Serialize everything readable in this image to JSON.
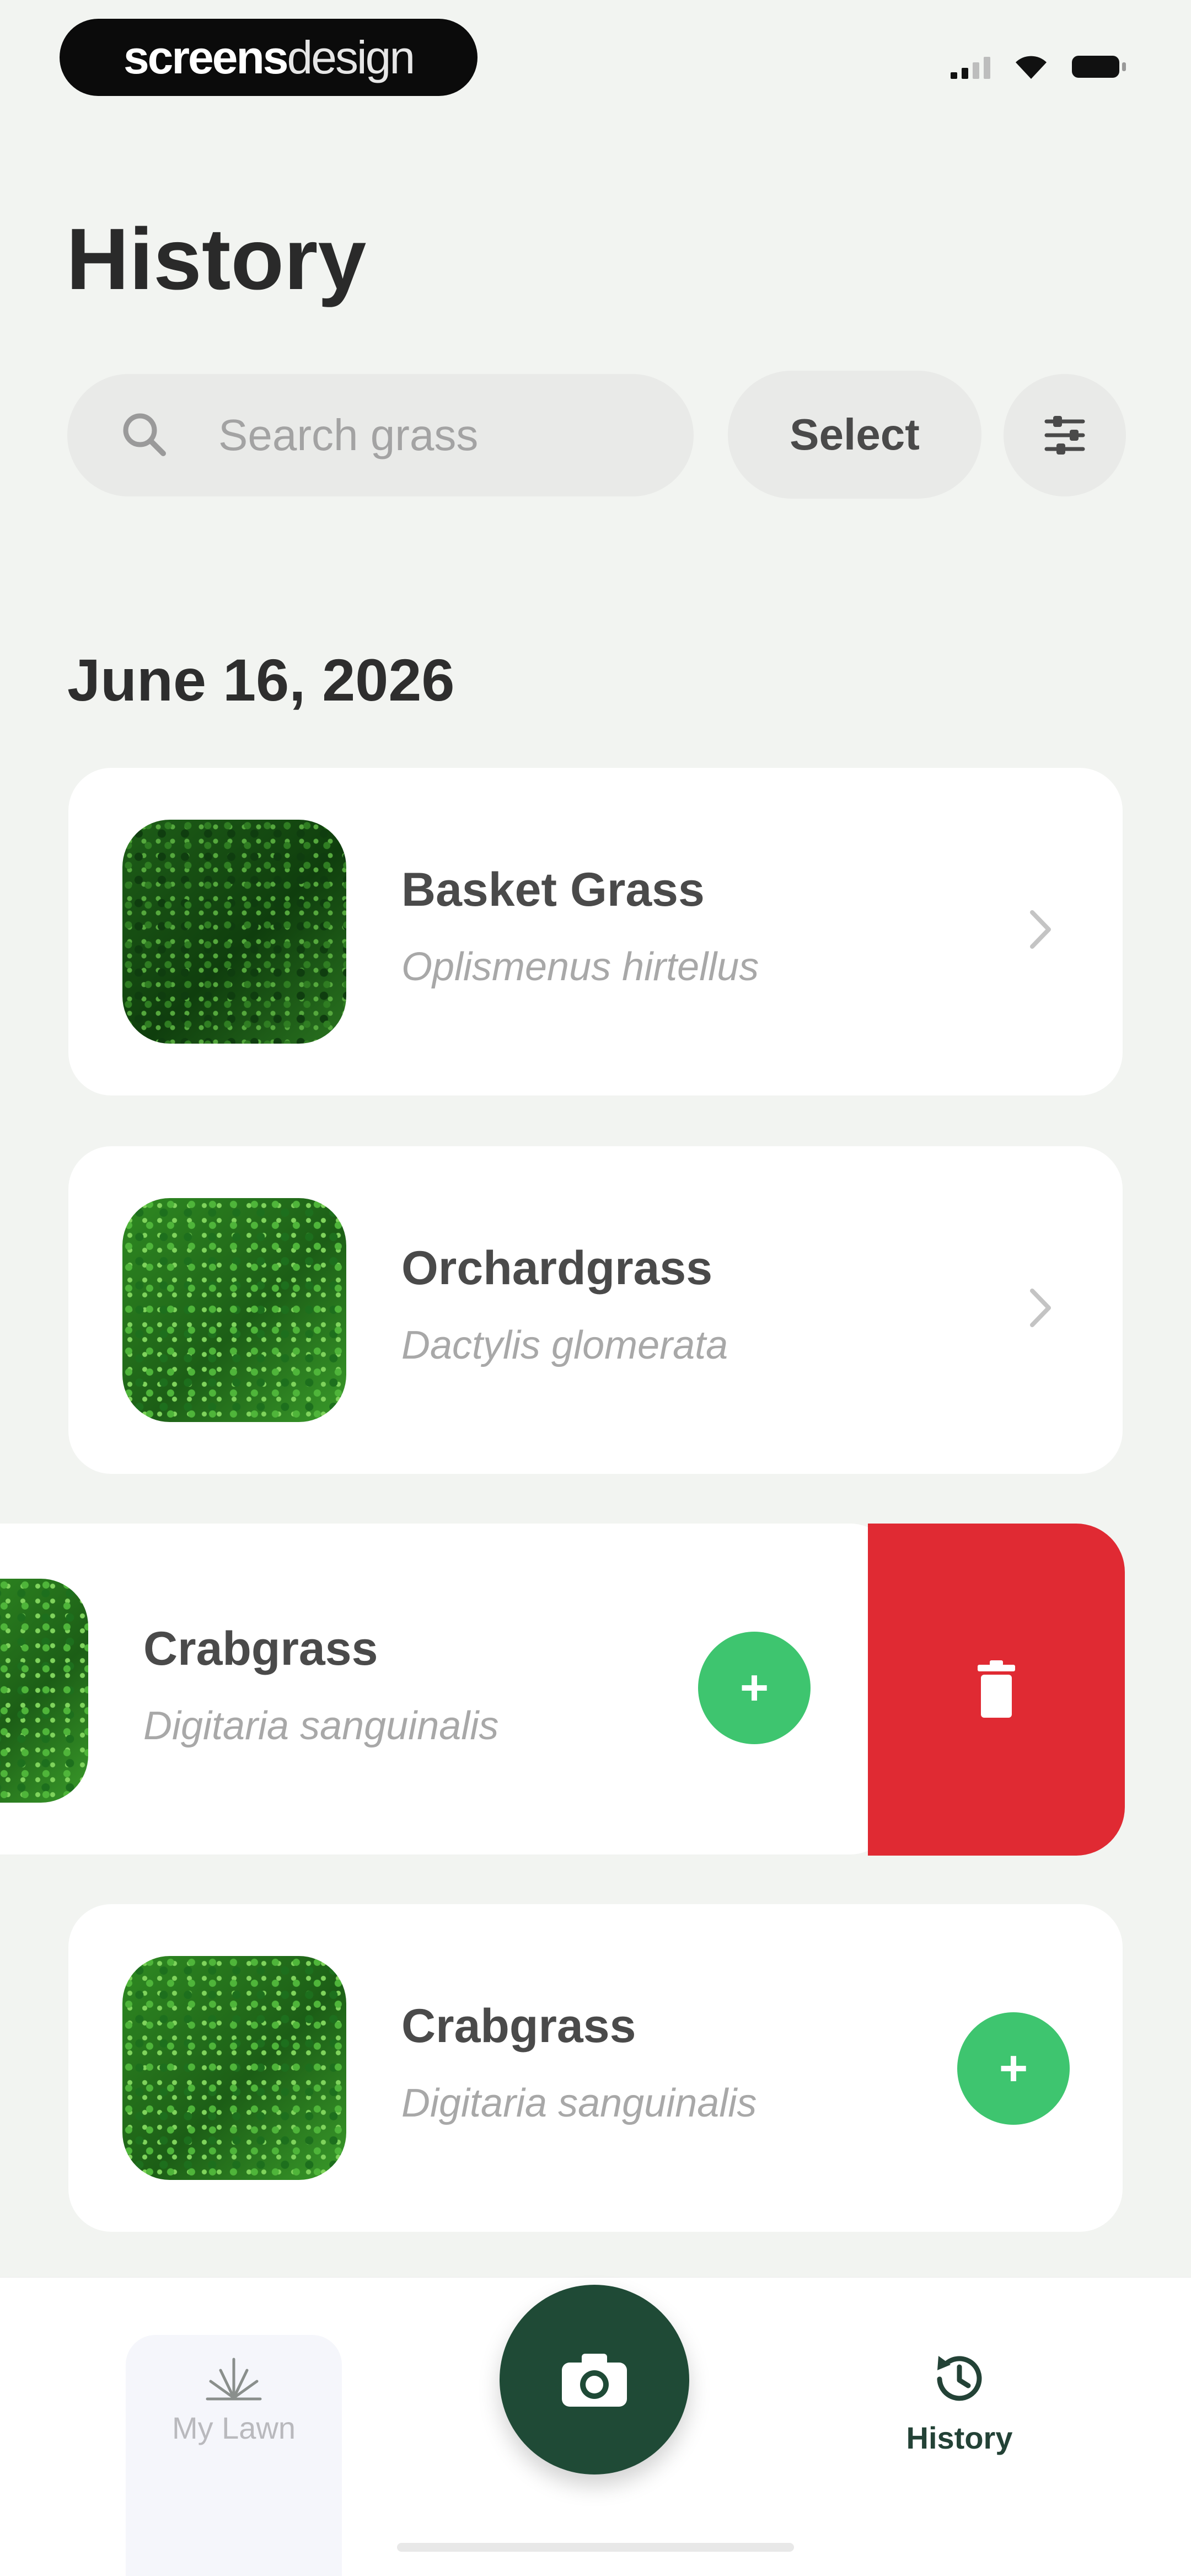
{
  "status_bar": {
    "brand_bold": "screens",
    "brand_light": "design"
  },
  "header": {
    "title": "History"
  },
  "search": {
    "placeholder": "Search grass",
    "select_label": "Select"
  },
  "sections": [
    {
      "date": "June 16, 2026",
      "items": [
        {
          "name": "Basket Grass",
          "scientific_name": "Oplismenus hirtellus",
          "action": "chevron"
        },
        {
          "name": "Orchardgrass",
          "scientific_name": "Dactylis glomerata",
          "action": "chevron"
        },
        {
          "name": "Crabgrass",
          "scientific_name": "Digitaria sanguinalis",
          "action": "add",
          "swiped": true
        },
        {
          "name": "Crabgrass",
          "scientific_name": "Digitaria sanguinalis",
          "action": "add"
        }
      ]
    }
  ],
  "tabbar": {
    "tabs": [
      {
        "label": "My Lawn",
        "icon": "lawn-icon",
        "active": false
      },
      {
        "label": "History",
        "icon": "history-icon",
        "active": true
      }
    ],
    "center_icon": "camera-icon"
  },
  "colors": {
    "background": "#f2f4f1",
    "accent_green": "#3ec56f",
    "delete_red": "#e02a33",
    "camera_button": "#1f4a36"
  }
}
